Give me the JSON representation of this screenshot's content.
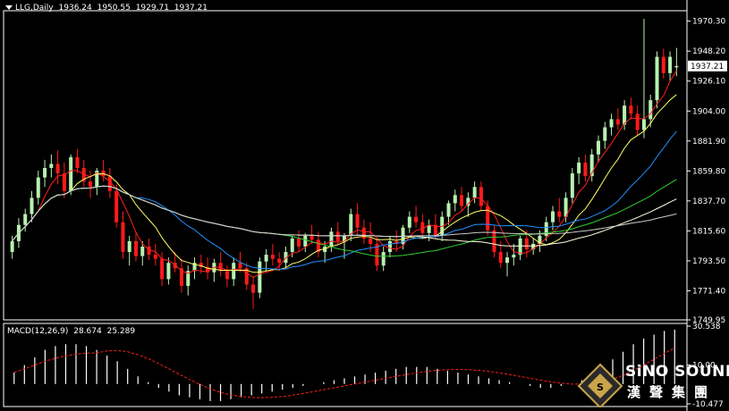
{
  "header": {
    "symbol": "LLG,Daily",
    "open": "1936.24",
    "high": "1950.55",
    "low": "1929.71",
    "close": "1937.21"
  },
  "macd_header": {
    "label": "MACD(12,26,9)",
    "main": "28.674",
    "signal": "25.289"
  },
  "price_axis": {
    "ticks": [
      "1970.30",
      "1948.20",
      "1926.10",
      "1904.00",
      "1881.90",
      "1859.80",
      "1837.70",
      "1815.60",
      "1793.50",
      "1771.40",
      "1749.95"
    ],
    "current_price_label": "1937.21"
  },
  "macd_axis": {
    "ticks": [
      "30.538",
      "10.00",
      "-10.477"
    ]
  },
  "logo": {
    "title": "SiNO SOUND",
    "subtitle": "漢聲集團"
  },
  "colors": {
    "background": "#000000",
    "up_candle": "#b8f0b0",
    "down_candle": "#ff1a1a",
    "ma5": "#ff2020",
    "ma10": "#ffff66",
    "ma20": "#1e90ff",
    "ma40": "#32cd32",
    "ma60": "#ffffe0",
    "ma120": "#cccccc",
    "macd_hist": "#ffffff",
    "macd_signal": "#ff2020",
    "axis": "#ffffff"
  },
  "chart_data": [
    {
      "type": "candlestick",
      "title": "LLG,Daily",
      "ylim": [
        1749.95,
        1978
      ],
      "candles": [
        [
          1800,
          1812,
          1795,
          1808
        ],
        [
          1808,
          1825,
          1803,
          1820
        ],
        [
          1820,
          1832,
          1815,
          1828
        ],
        [
          1828,
          1845,
          1822,
          1840
        ],
        [
          1840,
          1860,
          1835,
          1855
        ],
        [
          1855,
          1868,
          1848,
          1862
        ],
        [
          1862,
          1872,
          1855,
          1865
        ],
        [
          1865,
          1875,
          1850,
          1858
        ],
        [
          1858,
          1866,
          1840,
          1845
        ],
        [
          1845,
          1872,
          1842,
          1870
        ],
        [
          1870,
          1876,
          1858,
          1862
        ],
        [
          1862,
          1868,
          1848,
          1852
        ],
        [
          1852,
          1860,
          1840,
          1848
        ],
        [
          1848,
          1862,
          1842,
          1860
        ],
        [
          1860,
          1868,
          1852,
          1856
        ],
        [
          1856,
          1862,
          1840,
          1845
        ],
        [
          1845,
          1850,
          1818,
          1822
        ],
        [
          1822,
          1830,
          1795,
          1800
        ],
        [
          1800,
          1812,
          1790,
          1808
        ],
        [
          1808,
          1815,
          1793,
          1797
        ],
        [
          1797,
          1808,
          1790,
          1804
        ],
        [
          1804,
          1810,
          1794,
          1798
        ],
        [
          1798,
          1806,
          1790,
          1795
        ],
        [
          1795,
          1800,
          1775,
          1780
        ],
        [
          1780,
          1796,
          1776,
          1792
        ],
        [
          1792,
          1800,
          1785,
          1788
        ],
        [
          1788,
          1795,
          1770,
          1775
        ],
        [
          1775,
          1790,
          1768,
          1786
        ],
        [
          1786,
          1796,
          1780,
          1792
        ],
        [
          1792,
          1798,
          1784,
          1789
        ],
        [
          1789,
          1796,
          1780,
          1785
        ],
        [
          1785,
          1795,
          1778,
          1792
        ],
        [
          1792,
          1800,
          1782,
          1786
        ],
        [
          1786,
          1790,
          1774,
          1780
        ],
        [
          1780,
          1796,
          1775,
          1792
        ],
        [
          1792,
          1800,
          1785,
          1788
        ],
        [
          1788,
          1792,
          1772,
          1776
        ],
        [
          1776,
          1782,
          1758,
          1770
        ],
        [
          1770,
          1796,
          1766,
          1793
        ],
        [
          1793,
          1802,
          1786,
          1798
        ],
        [
          1798,
          1806,
          1790,
          1795
        ],
        [
          1795,
          1800,
          1786,
          1792
        ],
        [
          1792,
          1804,
          1788,
          1800
        ],
        [
          1800,
          1812,
          1796,
          1810
        ],
        [
          1810,
          1816,
          1800,
          1804
        ],
        [
          1804,
          1814,
          1800,
          1812
        ],
        [
          1812,
          1820,
          1806,
          1809
        ],
        [
          1809,
          1815,
          1796,
          1800
        ],
        [
          1800,
          1808,
          1792,
          1804
        ],
        [
          1804,
          1818,
          1800,
          1815
        ],
        [
          1815,
          1822,
          1805,
          1808
        ],
        [
          1808,
          1814,
          1795,
          1812
        ],
        [
          1812,
          1832,
          1808,
          1828
        ],
        [
          1828,
          1836,
          1812,
          1818
        ],
        [
          1818,
          1824,
          1806,
          1810
        ],
        [
          1810,
          1822,
          1800,
          1806
        ],
        [
          1806,
          1810,
          1786,
          1790
        ],
        [
          1790,
          1804,
          1786,
          1800
        ],
        [
          1800,
          1812,
          1796,
          1808
        ],
        [
          1808,
          1816,
          1800,
          1806
        ],
        [
          1806,
          1820,
          1802,
          1818
        ],
        [
          1818,
          1830,
          1814,
          1826
        ],
        [
          1826,
          1834,
          1818,
          1822
        ],
        [
          1822,
          1828,
          1810,
          1814
        ],
        [
          1814,
          1824,
          1808,
          1820
        ],
        [
          1820,
          1828,
          1810,
          1812
        ],
        [
          1812,
          1830,
          1808,
          1826
        ],
        [
          1826,
          1838,
          1820,
          1836
        ],
        [
          1836,
          1846,
          1830,
          1842
        ],
        [
          1842,
          1848,
          1830,
          1834
        ],
        [
          1834,
          1844,
          1826,
          1840
        ],
        [
          1840,
          1852,
          1836,
          1848
        ],
        [
          1848,
          1852,
          1830,
          1834
        ],
        [
          1834,
          1838,
          1812,
          1816
        ],
        [
          1816,
          1820,
          1796,
          1800
        ],
        [
          1800,
          1808,
          1788,
          1792
        ],
        [
          1792,
          1800,
          1782,
          1796
        ],
        [
          1796,
          1806,
          1790,
          1798
        ],
        [
          1798,
          1812,
          1794,
          1810
        ],
        [
          1810,
          1816,
          1796,
          1802
        ],
        [
          1802,
          1810,
          1798,
          1806
        ],
        [
          1806,
          1816,
          1800,
          1812
        ],
        [
          1812,
          1826,
          1808,
          1822
        ],
        [
          1822,
          1834,
          1816,
          1830
        ],
        [
          1830,
          1840,
          1822,
          1826
        ],
        [
          1826,
          1844,
          1822,
          1840
        ],
        [
          1840,
          1862,
          1836,
          1858
        ],
        [
          1858,
          1870,
          1850,
          1866
        ],
        [
          1866,
          1872,
          1852,
          1856
        ],
        [
          1856,
          1876,
          1852,
          1872
        ],
        [
          1872,
          1886,
          1866,
          1882
        ],
        [
          1882,
          1896,
          1876,
          1892
        ],
        [
          1892,
          1902,
          1886,
          1898
        ],
        [
          1898,
          1906,
          1890,
          1894
        ],
        [
          1894,
          1912,
          1890,
          1908
        ],
        [
          1908,
          1914,
          1898,
          1902
        ],
        [
          1902,
          1908,
          1886,
          1890
        ],
        [
          1890,
          1972,
          1884,
          1898
        ],
        [
          1898,
          1916,
          1892,
          1912
        ],
        [
          1912,
          1948,
          1906,
          1944
        ],
        [
          1944,
          1950,
          1928,
          1932
        ],
        [
          1932,
          1948,
          1926,
          1944
        ],
        [
          1936.24,
          1950.55,
          1929.71,
          1937.21
        ]
      ],
      "legend": []
    },
    {
      "type": "bar",
      "title": "MACD(12,26,9)",
      "ylim": [
        -10.477,
        30.538
      ],
      "values": [
        6,
        10,
        14,
        18,
        20,
        21,
        21,
        20,
        18,
        15,
        12,
        8,
        4,
        1,
        -2,
        -4,
        -6,
        -7,
        -8,
        -9,
        -9,
        -8,
        -7,
        -6,
        -5,
        -4,
        -3,
        -2,
        -1,
        0,
        1,
        2,
        3,
        4,
        5,
        6,
        7,
        8,
        9,
        9,
        9,
        8,
        7,
        6,
        5,
        4,
        3,
        2,
        1,
        0,
        -1,
        -2,
        -2,
        -1,
        0,
        2,
        5,
        9,
        13,
        17,
        21,
        24,
        26,
        28,
        28.674
      ]
    }
  ]
}
